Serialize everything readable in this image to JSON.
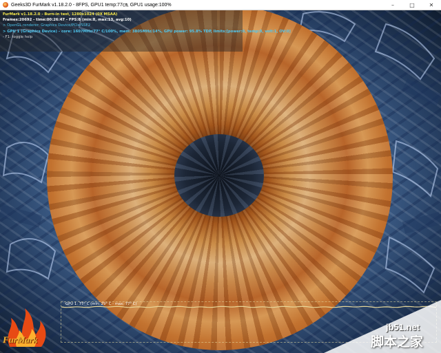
{
  "window": {
    "title": "Geeks3D FurMark v1.18.2.0 - 8FPS, GPU1 temp:77㎝, GPU1 usage:100%",
    "controls": {
      "minimize": "–",
      "maximize": "□",
      "close": "✕"
    }
  },
  "hud": {
    "lines": [
      "FurMark v1.18.2.0 - Burn-in test, 1280x1024 (0X MSAA)",
      "Frames:20692 - time:00:26:47 - FPS:8 (min:8, max:13, avg:10)",
      "> OpenGL renderer: Graphics Device/PCIe/SSE2",
      "> GPU 1 (Graphics Device) - core: 1607MHz/77° C/100%, mem: 3805MHz/14%, GPU power: 95.8% TDP, limits:[power:0, temp:0, volt:1, OV:0]",
      "- F1: toggle help"
    ]
  },
  "graph": {
    "label": "GPU 1: 77° C (min: 29° C - max: 77° C)",
    "color": "#e8d89a",
    "temperature_current": 77,
    "temperature_min": 29,
    "temperature_max": 77
  },
  "logo": {
    "text": "FurMark"
  },
  "watermark": {
    "site": "jb51.net",
    "cn": "脚本之家"
  },
  "colors": {
    "hud_title": "#f6e84a",
    "hud_info": "#4fc8f0",
    "titlebar_bg": "#ffffff"
  }
}
